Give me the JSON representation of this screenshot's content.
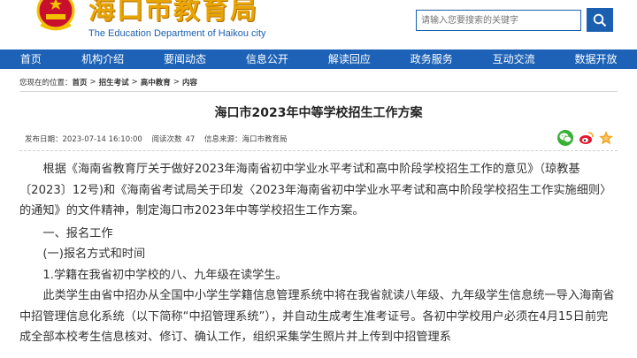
{
  "header": {
    "title_cn": "海口市教育局",
    "title_en": "The Education Department of Haikou city",
    "search_placeholder": "请输入您要搜索的关键字"
  },
  "nav": [
    "首页",
    "机构介绍",
    "要闻动态",
    "信息公开",
    "解读回应",
    "政务服务",
    "互动交流",
    "数据开放"
  ],
  "breadcrumb": {
    "prefix": "您现在的位置：",
    "items": [
      "首页",
      "招生考试",
      "高中教育",
      "内容"
    ]
  },
  "article": {
    "title": "海口市2023年中等学校招生工作方案",
    "publish_time": "发布日期：2023-07-14 16:10:00",
    "views_label": "阅读次数",
    "views": "47",
    "source": "信息来源：海口市教育局",
    "paragraphs": [
      "根据《海南省教育厅关于做好2023年海南省初中学业水平考试和高中阶段学校招生工作的意见》（琼教基〔2023〕12号)和《海南省考试局关于印发〈2023年海南省初中学业水平考试和高中阶段学校招生工作实施细则〉的通知》的文件精神，制定海口市2023年中等学校招生工作方案。",
      "一、报名工作",
      "(一)报名方式和时间",
      "1.学籍在我省初中学校的八、九年级在读学生。",
      "此类学生由省中招办从全国中小学生学籍信息管理系统中将在我省就读八年级、九年级学生信息统一导入海南省中招管理信息化系统（以下简称“中招管理系统”），并自动生成考生准考证号。各初中学校用户必须在4月15日前完成全部本校考生信息核对、修订、确认工作，组织采集学生照片并上传到中招管理系"
    ]
  },
  "colors": {
    "brand_blue": "#1d62b6",
    "title_gold": "#e8a500",
    "wechat_green": "#38b034",
    "weibo_red": "#e6162d",
    "star_orange": "#f5a623"
  },
  "icons": [
    "national-emblem-icon",
    "search-icon",
    "wechat-icon",
    "weibo-icon",
    "star-icon"
  ]
}
